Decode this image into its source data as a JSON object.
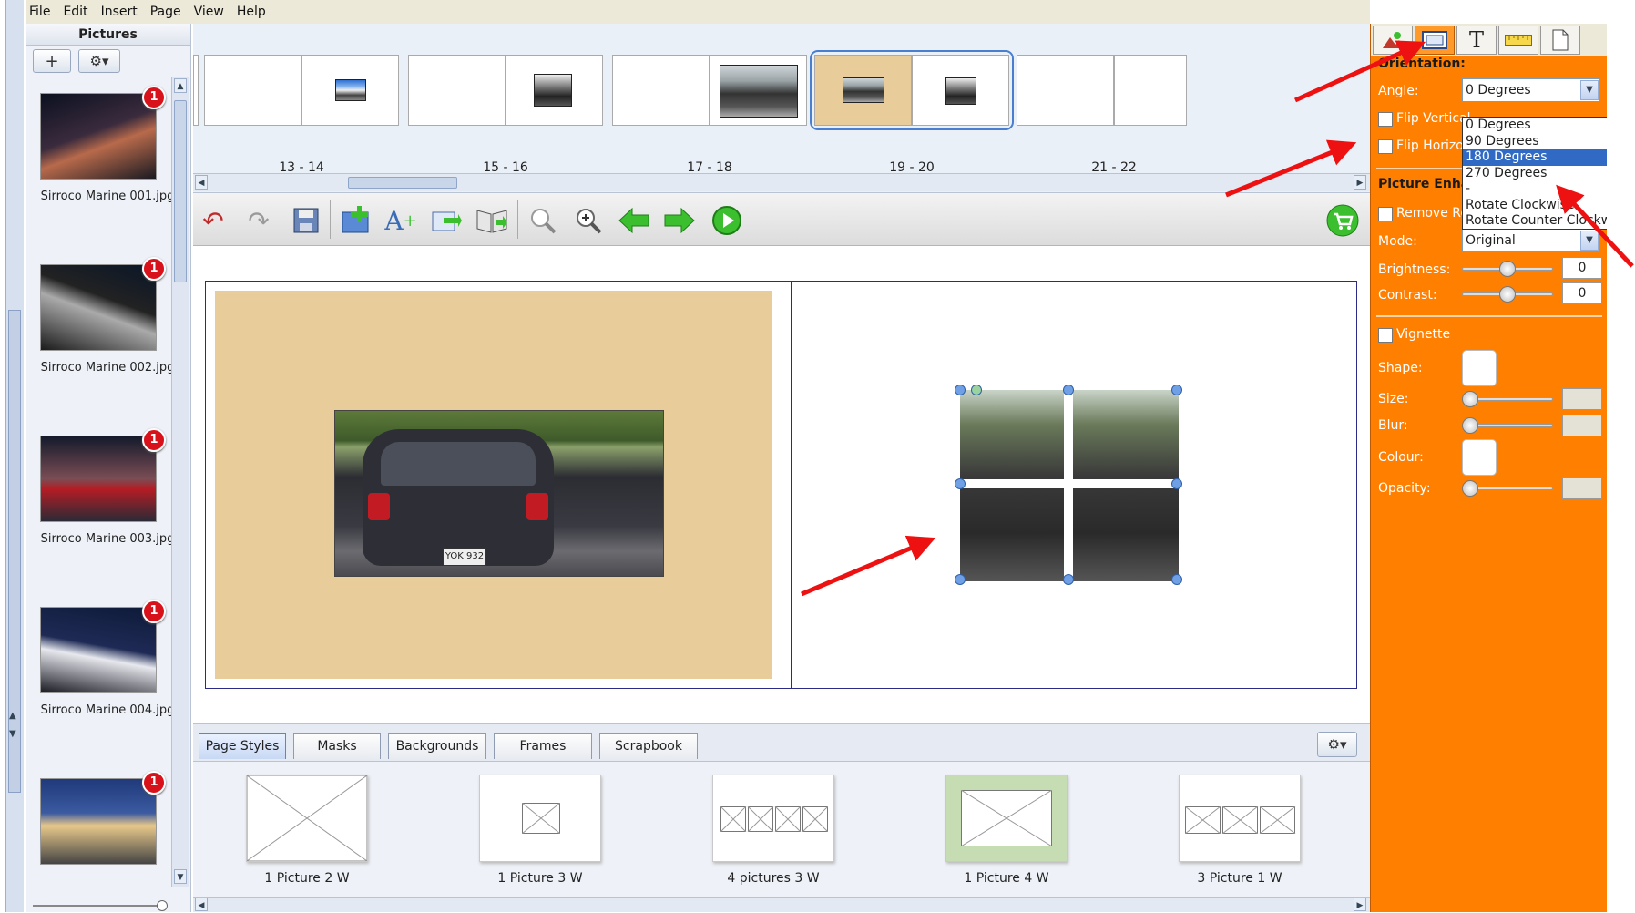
{
  "menu": [
    "File",
    "Edit",
    "Insert",
    "Page",
    "View",
    "Help"
  ],
  "pictures": {
    "title": "Pictures",
    "add_label": "+",
    "gear_label": "⚙▾",
    "items": [
      {
        "name": "Sirroco Marine 001.jpg",
        "badge": "1"
      },
      {
        "name": "Sirroco Marine 002.jpg",
        "badge": "1"
      },
      {
        "name": "Sirroco Marine 003.jpg",
        "badge": "1"
      },
      {
        "name": "Sirroco Marine 004.jpg",
        "badge": "1"
      },
      {
        "name": "",
        "badge": "1"
      }
    ]
  },
  "spreads": [
    {
      "label": "13 - 14"
    },
    {
      "label": "15 - 16"
    },
    {
      "label": "17 - 18"
    },
    {
      "label": "19 - 20",
      "selected": true
    },
    {
      "label": "21 - 22"
    }
  ],
  "toolbar": {
    "icons": [
      "undo-icon",
      "redo-icon",
      "save-icon",
      "add-picture-icon",
      "add-text-icon",
      "import-icon",
      "book-icon",
      "zoom-out-icon",
      "zoom-in-icon",
      "previous-page-icon",
      "next-page-icon",
      "play-icon",
      "cart-icon"
    ]
  },
  "canvas": {
    "left_page_color": "#e8cd9b",
    "plate_text": "YOK 932"
  },
  "tabs": [
    {
      "label": "Page Styles",
      "active": true
    },
    {
      "label": "Masks"
    },
    {
      "label": "Backgrounds"
    },
    {
      "label": "Frames"
    },
    {
      "label": "Scrapbook"
    }
  ],
  "page_styles": [
    {
      "label": "1 Picture 2 W"
    },
    {
      "label": "1 Picture 3 W"
    },
    {
      "label": "4 pictures 3 W"
    },
    {
      "label": "1 Picture 4 W"
    },
    {
      "label": "3 Picture 1 W"
    }
  ],
  "right_panel": {
    "accent_color": "#ff7f00",
    "orientation_title": "Orientation:",
    "angle_label": "Angle:",
    "angle_value": "0 Degrees",
    "angle_options": [
      "0 Degrees",
      "90 Degrees",
      "180 Degrees",
      "270 Degrees",
      "-",
      "Rotate Clockwise",
      "Rotate Counter Clockwise"
    ],
    "angle_highlighted": "180 Degrees",
    "flip_vertical": "Flip Vertical",
    "flip_horizontal": "Flip Horizontal",
    "enhance_title": "Picture Enhancements",
    "remove_red_eye": "Remove Red Eye",
    "mode_label": "Mode:",
    "mode_value": "Original",
    "brightness_label": "Brightness:",
    "brightness_value": "0",
    "contrast_label": "Contrast:",
    "contrast_value": "0",
    "vignette_label": "Vignette",
    "shape_label": "Shape:",
    "size_label": "Size:",
    "blur_label": "Blur:",
    "colour_label": "Colour:",
    "opacity_label": "Opacity:"
  }
}
